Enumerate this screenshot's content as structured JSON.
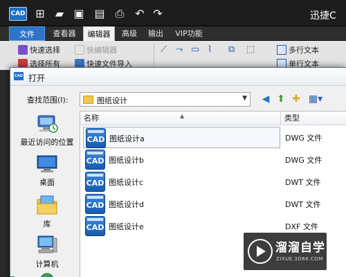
{
  "app": {
    "logo_text": "CAD",
    "title": "迅捷C"
  },
  "quick_access": [
    {
      "icon": "new-file-icon",
      "glyph": "⊞"
    },
    {
      "icon": "open-folder-icon",
      "glyph": "▰"
    },
    {
      "icon": "save-icon",
      "glyph": "▣"
    },
    {
      "icon": "save-as-icon",
      "glyph": "▤"
    },
    {
      "icon": "print-icon",
      "glyph": "⎙"
    },
    {
      "icon": "undo-icon",
      "glyph": "↶"
    },
    {
      "icon": "redo-icon",
      "glyph": "↷"
    }
  ],
  "menu": {
    "file": "文件",
    "viewer": "查看器",
    "editor": "编辑器",
    "advanced": "高级",
    "output": "输出",
    "vip": "VIP功能"
  },
  "ribbon": {
    "quick_select": "快速选择",
    "quick_edit": "快编辑器",
    "select_all": "选择所有",
    "quick_file_import": "快速文件导入",
    "multiline_text": "多行文本",
    "single_line_text": "单行文本"
  },
  "dialog": {
    "title": "打开",
    "look_in_label": "查找范围(I):",
    "look_in_value": "图纸设计",
    "places": [
      {
        "label": "最近访问的位置",
        "icon": "recent-places-icon"
      },
      {
        "label": "桌面",
        "icon": "desktop-icon"
      },
      {
        "label": "库",
        "icon": "libraries-icon"
      },
      {
        "label": "计算机",
        "icon": "computer-icon"
      }
    ],
    "columns": {
      "name": "名称",
      "type": "类型"
    },
    "files": [
      {
        "name": "图纸设计a",
        "type": "DWG 文件"
      },
      {
        "name": "图纸设计b",
        "type": "DWG 文件"
      },
      {
        "name": "图纸设计c",
        "type": "DWT 文件"
      },
      {
        "name": "图纸设计d",
        "type": "DWT 文件"
      },
      {
        "name": "图纸设计e",
        "type": "DXF 文件"
      }
    ],
    "file_icon_text": "CAD"
  },
  "watermark": {
    "text": "溜溜自学",
    "sub": "ZIXUE.3D66.COM"
  },
  "colors": {
    "accent": "#2e74c7",
    "folder": "#f3c54a",
    "cad_icon": "#1e6fc8"
  }
}
